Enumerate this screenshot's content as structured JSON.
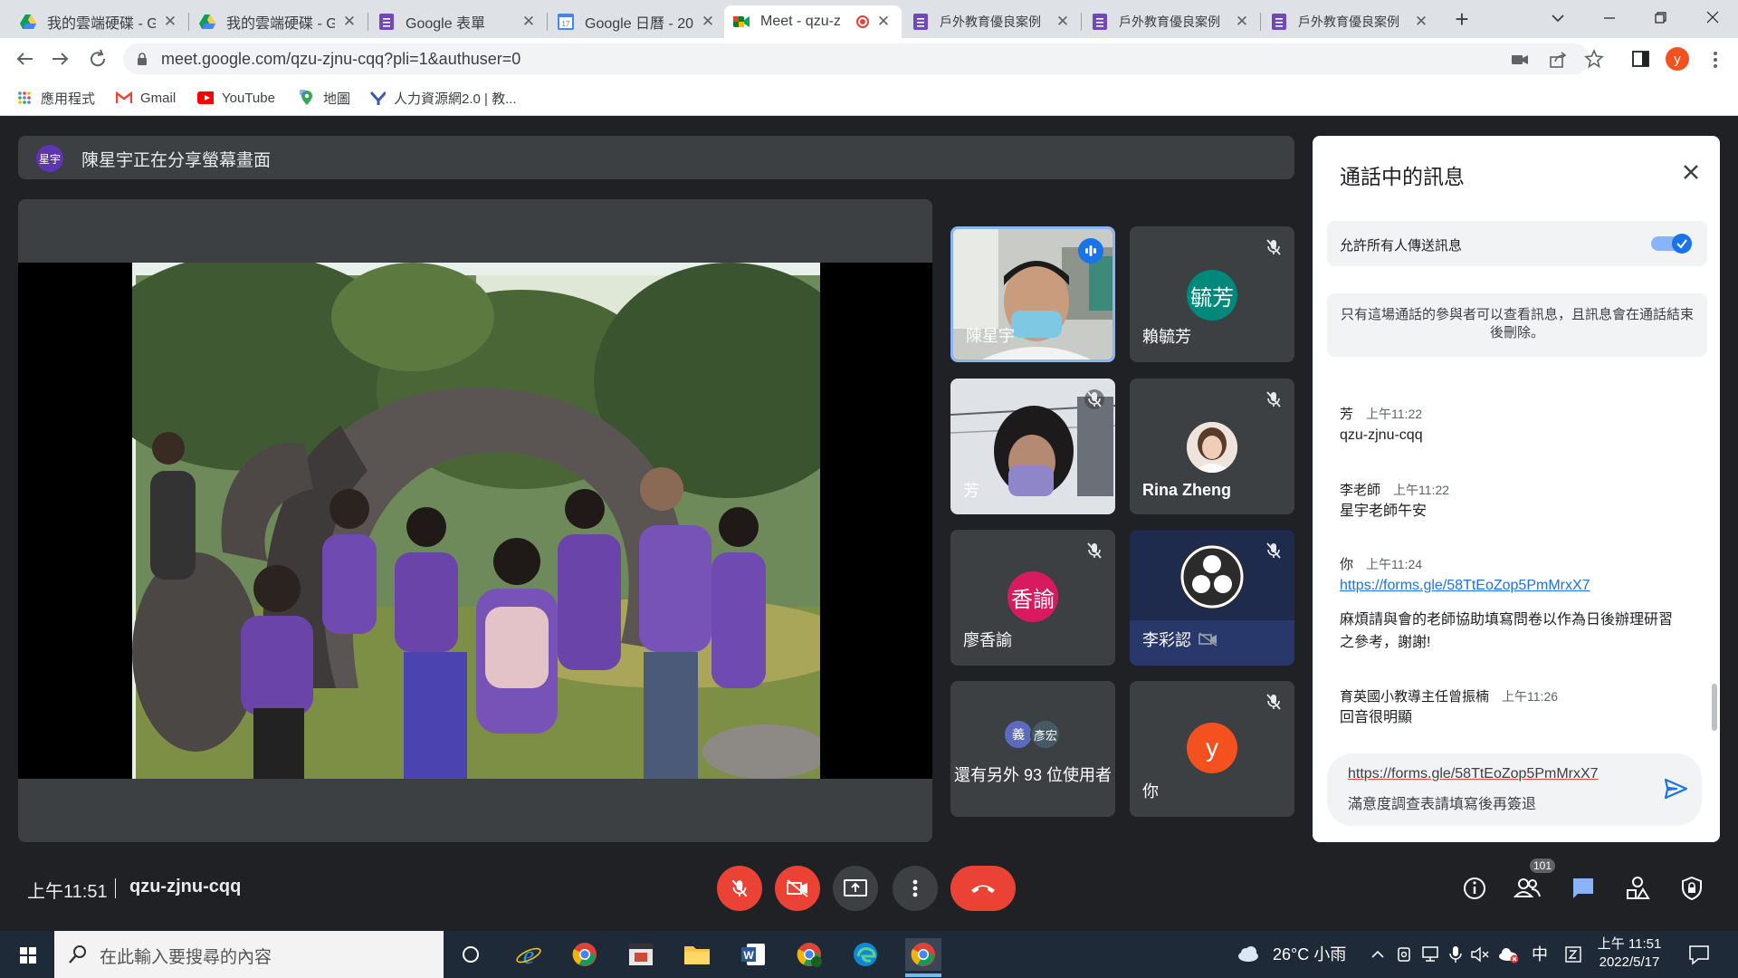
{
  "browser": {
    "tabs": [
      {
        "title": "我的雲端硬碟 - Go",
        "icon": "google-drive-icon"
      },
      {
        "title": "我的雲端硬碟 - Go",
        "icon": "google-drive-icon"
      },
      {
        "title": "Google 表單",
        "icon": "google-forms-icon"
      },
      {
        "title": "Google 日曆 - 20",
        "icon": "google-calendar-icon"
      },
      {
        "title": "Meet - qzu-z",
        "icon": "google-meet-icon",
        "active": true
      },
      {
        "title": "戶外教育優良案例",
        "icon": "google-forms-icon"
      },
      {
        "title": "戶外教育優良案例",
        "icon": "google-forms-icon"
      },
      {
        "title": "戶外教育優良案例",
        "icon": "google-forms-icon"
      }
    ],
    "url": "meet.google.com/qzu-zjnu-cqq?pli=1&authuser=0",
    "profile_initial": "y",
    "bookmarks": [
      {
        "label": "應用程式",
        "icon": "apps-grid-icon"
      },
      {
        "label": "Gmail",
        "icon": "gmail-icon"
      },
      {
        "label": "YouTube",
        "icon": "youtube-icon"
      },
      {
        "label": "地圖",
        "icon": "maps-icon"
      },
      {
        "label": "人力資源網2.0 | 教...",
        "icon": "hr-icon"
      }
    ]
  },
  "meet": {
    "presenter_initials": "星宇",
    "presenting_text": "陳星宇正在分享螢幕畫面",
    "participants": [
      {
        "name": "陳星宇",
        "type": "video",
        "speaking": true
      },
      {
        "name": "賴毓芳",
        "initials": "毓芳",
        "color": "#00897b",
        "muted": true
      },
      {
        "name": "芳",
        "type": "video",
        "muted": true
      },
      {
        "name": "Rina Zheng",
        "type": "photo",
        "muted": true
      },
      {
        "name": "廖香諭",
        "initials": "香諭",
        "color": "#d81b60",
        "muted": true
      },
      {
        "name": "李彩認",
        "type": "obs",
        "muted": true
      },
      {
        "name": "還有另外 93 位使用者",
        "mini_initials": [
          "義",
          "彥宏"
        ]
      },
      {
        "name": "你",
        "initials": "y",
        "color": "#f4511e",
        "muted": true
      }
    ],
    "time": "上午11:51",
    "meeting_code": "qzu-zjnu-cqq",
    "participant_count": "101"
  },
  "chat": {
    "title": "通話中的訊息",
    "allow_label": "允許所有人傳送訊息",
    "allow_enabled": true,
    "notice": "只有這場通話的參與者可以查看訊息，且訊息會在通話結束後刪除。",
    "messages": [
      {
        "sender": "芳",
        "time": "上午11:22",
        "lines": [
          "qzu-zjnu-cqq"
        ]
      },
      {
        "sender": "李老師",
        "time": "上午11:22",
        "lines": [
          "星宇老師午安"
        ]
      },
      {
        "sender": "你",
        "time": "上午11:24",
        "link": "https://forms.gle/58TtEoZop5PmMrxX7",
        "lines": [
          "麻煩請與會的老師協助填寫問卷以作為日後辦理研習",
          "之參考，謝謝!"
        ]
      },
      {
        "sender": "育英國小教導主任曾振楠",
        "time": "上午11:26",
        "lines": [
          "回音很明顯"
        ]
      }
    ],
    "compose_line1": "https://forms.gle/58TtEoZop5PmMrxX7",
    "compose_line2": "滿意度調查表請填寫後再簽退"
  },
  "taskbar": {
    "search_placeholder": "在此輸入要搜尋的內容",
    "weather": "26°C 小雨",
    "ime": "中",
    "time": "上午 11:51",
    "date": "2022/5/17"
  },
  "colors": {
    "meet_bg": "#202124",
    "danger": "#ea4335",
    "accent": "#1a73e8"
  }
}
